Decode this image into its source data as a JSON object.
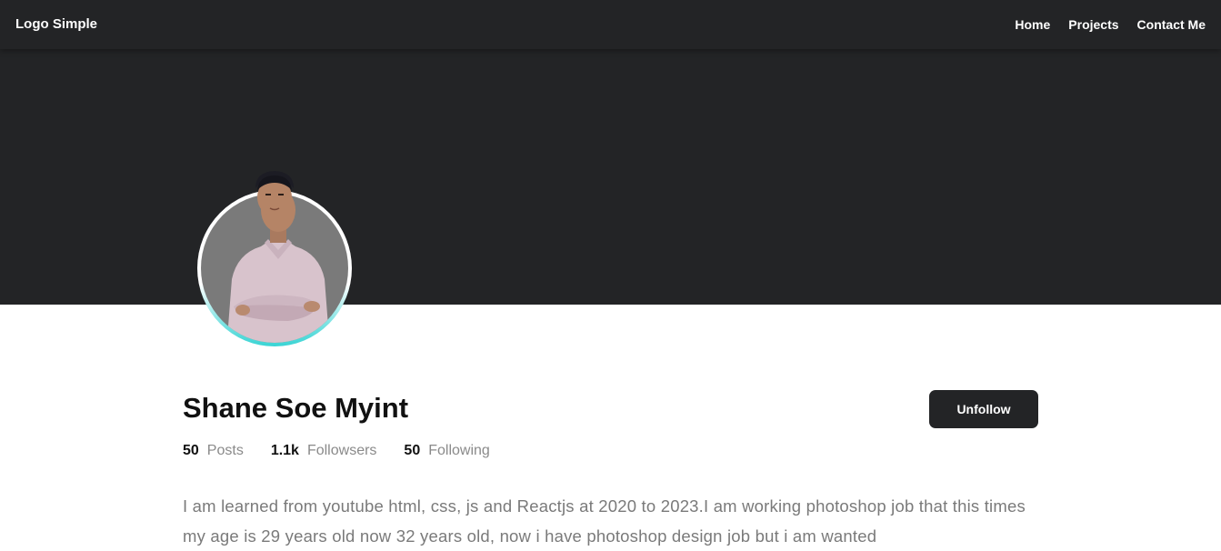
{
  "navbar": {
    "logo": "Logo Simple",
    "links": [
      {
        "label": "Home"
      },
      {
        "label": "Projects"
      },
      {
        "label": "Contact Me"
      }
    ]
  },
  "profile": {
    "name": "Shane Soe Myint",
    "stats": [
      {
        "value": "50",
        "label": "Posts"
      },
      {
        "value": "1.1k",
        "label": "Followsers"
      },
      {
        "value": "50",
        "label": "Following"
      }
    ],
    "unfollow_label": "Unfollow",
    "bio": "I am learned from youtube html, css, js and Reactjs at 2020 to 2023.I am working photoshop job that this times my age is 29 years old now 32 years old, now i have photoshop design job but i am wanted"
  },
  "colors": {
    "navbar_bg": "#232426",
    "cover_bg": "#232426",
    "avatar_ring_accent": "#38d4d4",
    "button_bg": "#232426",
    "muted_text": "#8a8a8a"
  }
}
